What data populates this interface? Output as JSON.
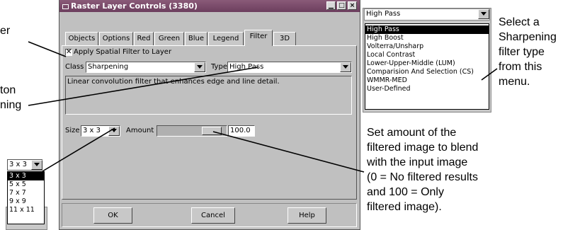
{
  "window": {
    "title": "Raster Layer Controls (3380)",
    "controls": {
      "minimize": "▁",
      "maximize": "□",
      "close": "×"
    }
  },
  "tabs": [
    "Objects",
    "Options",
    "Red",
    "Green",
    "Blue",
    "Legend",
    "Filter",
    "3D"
  ],
  "active_tab": "Filter",
  "filter_panel": {
    "apply_label": "Apply Spatial Filter to Layer",
    "apply_checked": true,
    "class_label": "Class",
    "class_value": "Sharpening",
    "type_label": "Type",
    "type_value": "High Pass",
    "description": "Linear convolution filter that enhances edge and line detail.",
    "size_label": "Size",
    "size_value": "3 x 3",
    "amount_label": "Amount",
    "amount_value": "100.0",
    "amount_fraction": 0.9
  },
  "buttons": {
    "ok": "OK",
    "cancel": "Cancel",
    "help": "Help"
  },
  "type_menu": {
    "current": "High Pass",
    "items": [
      "High Pass",
      "High Boost",
      "Volterra/Unsharp",
      "Local Contrast",
      "Lower-Upper-Middle (LUM)",
      "Comparision And Selection (CS)",
      "WMMR-MED",
      "User-Defined"
    ],
    "selected_index": 0
  },
  "size_menu": {
    "current": "3 x 3",
    "items": [
      "3 x 3",
      "5 x 5",
      "7 x 7",
      "9 x 9",
      "11 x 11"
    ],
    "selected_index": 0
  },
  "callouts": {
    "left_top": "er",
    "left_mid": "ton\nning",
    "select_type": "Select a\nSharpening\nfilter type\nfrom this\nmenu.",
    "amount_note": "Set amount of the\nfiltered image to blend\nwith the input image\n(0 = No filtered results\nand 100 = Only\nfiltered image)."
  },
  "icons": {
    "window_icon": "window-icon",
    "dropdown": "chevron-down-icon"
  },
  "colors": {
    "titlebar": "#7a4a6a",
    "dialog_bg": "#c0c0c0",
    "menu_selected": "#000000"
  }
}
